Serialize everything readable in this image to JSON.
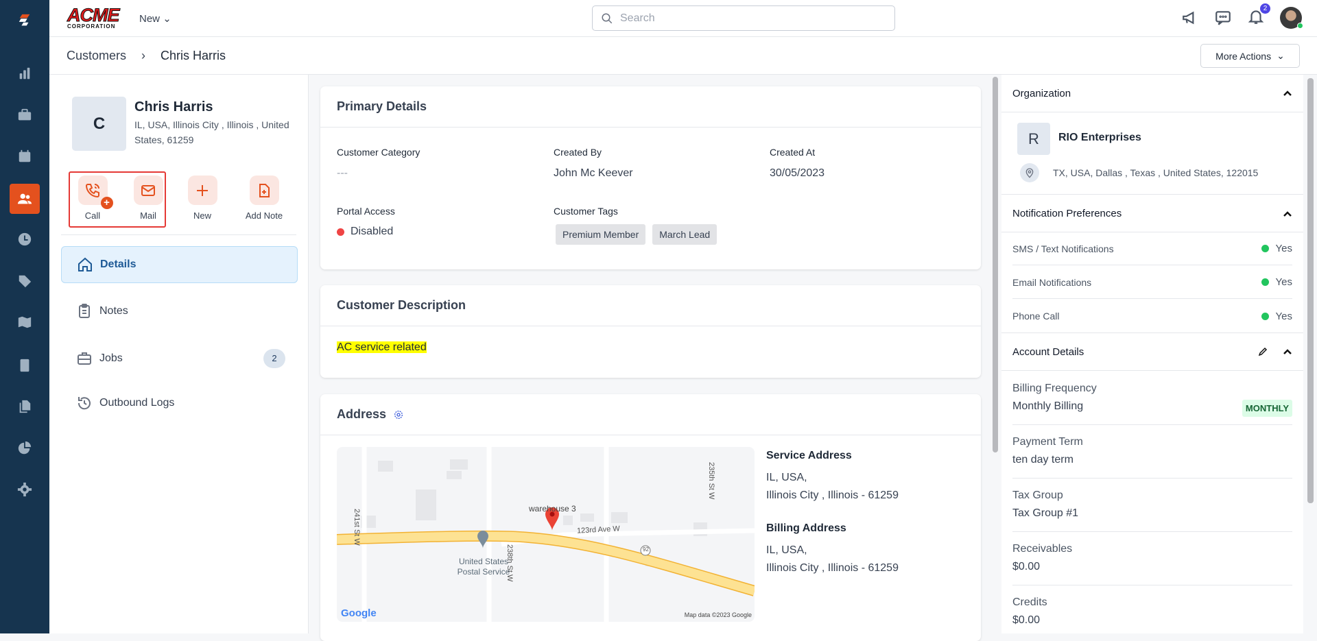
{
  "header": {
    "logo": "ACME",
    "logo_sub": "CORPORATION",
    "new_label": "New",
    "search_placeholder": "Search",
    "notification_count": "2"
  },
  "breadcrumb": {
    "parent": "Customers",
    "current": "Chris Harris"
  },
  "more_actions": "More Actions",
  "customer": {
    "initial": "C",
    "name": "Chris Harris",
    "address": "IL, USA, Illinois City , Illinois , United States, 61259"
  },
  "actions": [
    {
      "label": "Call"
    },
    {
      "label": "Mail"
    },
    {
      "label": "New"
    },
    {
      "label": "Add Note"
    }
  ],
  "nav": [
    {
      "label": "Details"
    },
    {
      "label": "Notes"
    },
    {
      "label": "Jobs",
      "count": "2"
    },
    {
      "label": "Outbound Logs"
    }
  ],
  "primary": {
    "title": "Primary Details",
    "customer_category_label": "Customer Category",
    "customer_category": "---",
    "created_by_label": "Created By",
    "created_by": "John Mc Keever",
    "created_at_label": "Created At",
    "created_at": "30/05/2023",
    "portal_access_label": "Portal Access",
    "portal_access": "Disabled",
    "tags_label": "Customer Tags",
    "tags": [
      "Premium Member",
      "March Lead"
    ]
  },
  "description": {
    "title": "Customer Description",
    "text": "AC service related"
  },
  "address": {
    "title": "Address",
    "map": {
      "streets": [
        "241st St W",
        "238th St W",
        "235th St W",
        "123rd Ave W"
      ],
      "route": "92",
      "place": "warehouse 3",
      "poi": "United States Postal Service",
      "google": "Google",
      "attribution": "Map data ©2023 Google"
    },
    "service_label": "Service Address",
    "service_line1": "IL, USA,",
    "service_line2": "Illinois City , Illinois - 61259",
    "billing_label": "Billing Address",
    "billing_line1": "IL, USA,",
    "billing_line2": "Illinois City , Illinois - 61259"
  },
  "organization": {
    "title": "Organization",
    "initial": "R",
    "name": "RIO Enterprises",
    "address": "TX, USA, Dallas , Texas , United States, 122015"
  },
  "notifications": {
    "title": "Notification Preferences",
    "items": [
      {
        "label": "SMS / Text Notifications",
        "value": "Yes"
      },
      {
        "label": "Email Notifications",
        "value": "Yes"
      },
      {
        "label": "Phone Call",
        "value": "Yes"
      }
    ]
  },
  "account": {
    "title": "Account Details",
    "items": [
      {
        "label": "Billing Frequency",
        "value": "Monthly Billing",
        "badge": "MONTHLY"
      },
      {
        "label": "Payment Term",
        "value": "ten day term"
      },
      {
        "label": "Tax Group",
        "value": "Tax Group #1"
      },
      {
        "label": "Receivables",
        "value": "$0.00"
      },
      {
        "label": "Credits",
        "value": "$0.00"
      }
    ]
  }
}
